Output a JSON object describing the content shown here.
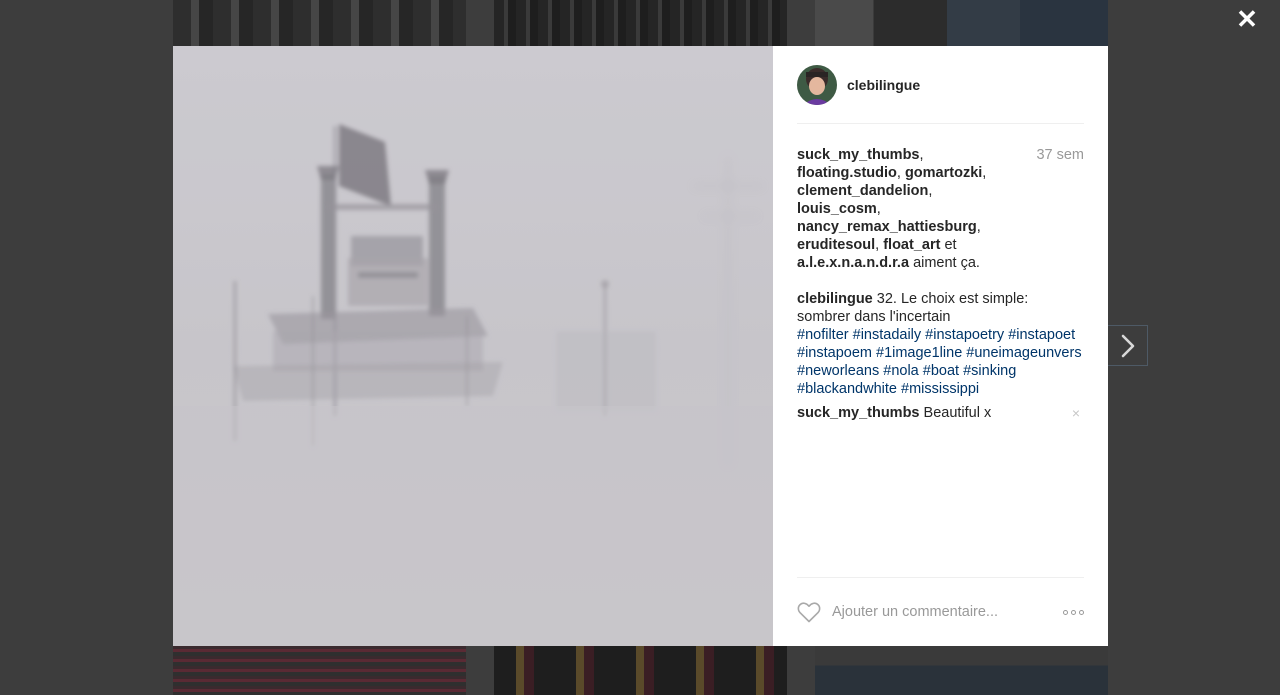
{
  "post": {
    "author": "clebilingue",
    "timestamp": "37 sem",
    "likes": {
      "users": [
        "suck_my_thumbs",
        "floating.studio",
        "gomartozki",
        "clement_dandelion",
        "louis_cosm",
        "nancy_remax_hattiesburg",
        "eruditesoul",
        "float_art",
        "a.l.e.x.n.a.n.d.r.a"
      ],
      "connector": "et",
      "suffix": "aiment ça."
    },
    "caption": {
      "user": "clebilingue",
      "text": "32. Le choix est simple: sombrer dans l'incertain",
      "hashtags": [
        "#nofilter",
        "#instadaily",
        "#instapoetry",
        "#instapoet",
        "#instapoem",
        "#1image1line",
        "#uneimageunvers",
        "#neworleans",
        "#nola",
        "#boat",
        "#sinking",
        "#blackandwhite",
        "#mississippi"
      ]
    },
    "comments": [
      {
        "user": "suck_my_thumbs",
        "text": "Beautiful x",
        "delete_icon": "×"
      }
    ]
  },
  "footer": {
    "comment_placeholder": "Ajouter un commentaire..."
  },
  "icons": {
    "close": "✕",
    "next": "chevron-right",
    "heart": "heart-outline",
    "more": "more-dots"
  },
  "colors": {
    "hashtag": "#003569",
    "overlay": "#3d3d3d",
    "muted": "#999999"
  }
}
